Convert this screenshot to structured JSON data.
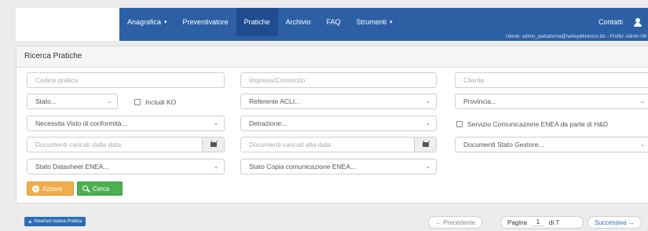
{
  "header": {
    "nav": [
      {
        "label": "Anagrafica",
        "has_caret": true,
        "active": false
      },
      {
        "label": "Preventivatore",
        "has_caret": false,
        "active": false
      },
      {
        "label": "Pratiche",
        "has_caret": false,
        "active": true
      },
      {
        "label": "Archivio",
        "has_caret": false,
        "active": false
      },
      {
        "label": "FAQ",
        "has_caret": false,
        "active": false
      },
      {
        "label": "Strumenti",
        "has_caret": true,
        "active": false
      }
    ],
    "contacts_label": "Contatti",
    "user_line": "Utente: admin_piattaforma@harleydikkinson.biz - Profilo: Admin H8",
    "bar_color": "#2d5fa5"
  },
  "panel": {
    "title": "Ricerca Pratiche",
    "row1": {
      "codice_pratica": {
        "placeholder": "Codice pratica",
        "value": ""
      },
      "impresa": {
        "placeholder": "Impresa/Consorzio",
        "value": ""
      },
      "cliente": {
        "placeholder": "Cliente",
        "value": ""
      }
    },
    "row2": {
      "stato": "Stato...",
      "includi_ko": "Includi KO",
      "referente": "Referente ACLI...",
      "provincia": "Provincia..."
    },
    "row3": {
      "visto": "Necessita Visto di conformità...",
      "detrazione": "Detrazione...",
      "servizio_enea": "Servizio Comunicazione ENEA da parte di H&D"
    },
    "row4": {
      "docs_from": "Documenti caricati dalla data",
      "docs_to": "Documenti caricati alla data",
      "stato_gestore": "Documenti Stato Gestore..."
    },
    "row5": {
      "datasheet": "Stato Datasheet ENEA...",
      "copia": "Stato Copia comunicazione ENEA..."
    },
    "buttons": {
      "reset": "Azzera",
      "search": "Cerca"
    }
  },
  "footer": {
    "new_button": "Inserisci nuova Pratica",
    "prev": "← Precedente",
    "page_label": "Pagina",
    "page_number": "1",
    "page_total": "di 7",
    "next": "Successiva →"
  }
}
